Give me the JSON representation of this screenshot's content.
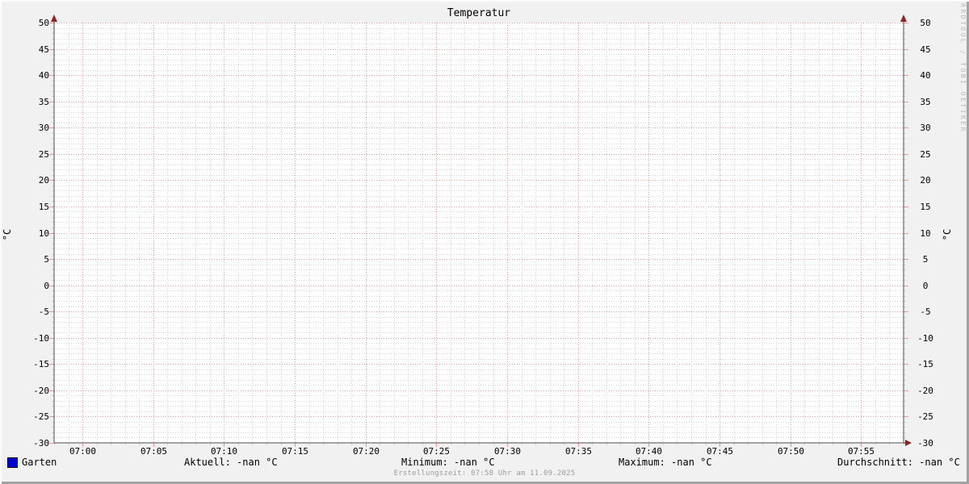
{
  "chart_data": {
    "type": "line",
    "title": "Temperatur",
    "ylabel_left": "°C",
    "ylabel_right": "°C",
    "ylim": [
      -30,
      50
    ],
    "y_major_step": 5,
    "y_minor_step": 1,
    "x_start": "06:58",
    "x_end": "07:58",
    "x_major_every_min": 5,
    "x_minor_every_min": 1,
    "x_tick_labels": [
      "07:00",
      "07:05",
      "07:10",
      "07:15",
      "07:20",
      "07:25",
      "07:30",
      "07:35",
      "07:40",
      "07:45",
      "07:50",
      "07:55"
    ],
    "y_tick_labels": [
      "50",
      "45",
      "40",
      "35",
      "30",
      "25",
      "20",
      "15",
      "10",
      "5",
      "0",
      "-5",
      "-10",
      "-15",
      "-20",
      "-25",
      "-30"
    ],
    "grid": true,
    "legend_position": "bottom",
    "series": [
      {
        "name": "Garten",
        "color": "#0000cc",
        "values": []
      }
    ],
    "stats": {
      "aktuell": "Aktuell: -nan °C",
      "minimum": "Minimum: -nan °C",
      "maximum": "Maximum: -nan °C",
      "durchschnitt": "Durchschnitt: -nan °C"
    }
  },
  "footer": {
    "text": "Erstellungszeit: 07:58 Uhr am 11.09.2025"
  },
  "watermark": {
    "text": "RRDTOOL / TOBI OETIKER"
  },
  "colors": {
    "background": "#f1f1f1",
    "canvas": "#ffffff",
    "major_grid": "#e79898",
    "minor_grid": "#d4d4d4",
    "axis": "#4d4d4d",
    "arrow": "#8b2525",
    "text": "#000000",
    "muted_text": "#9c9c9c",
    "watermark": "#b9b9b9",
    "series_garten": "#0000cc"
  }
}
